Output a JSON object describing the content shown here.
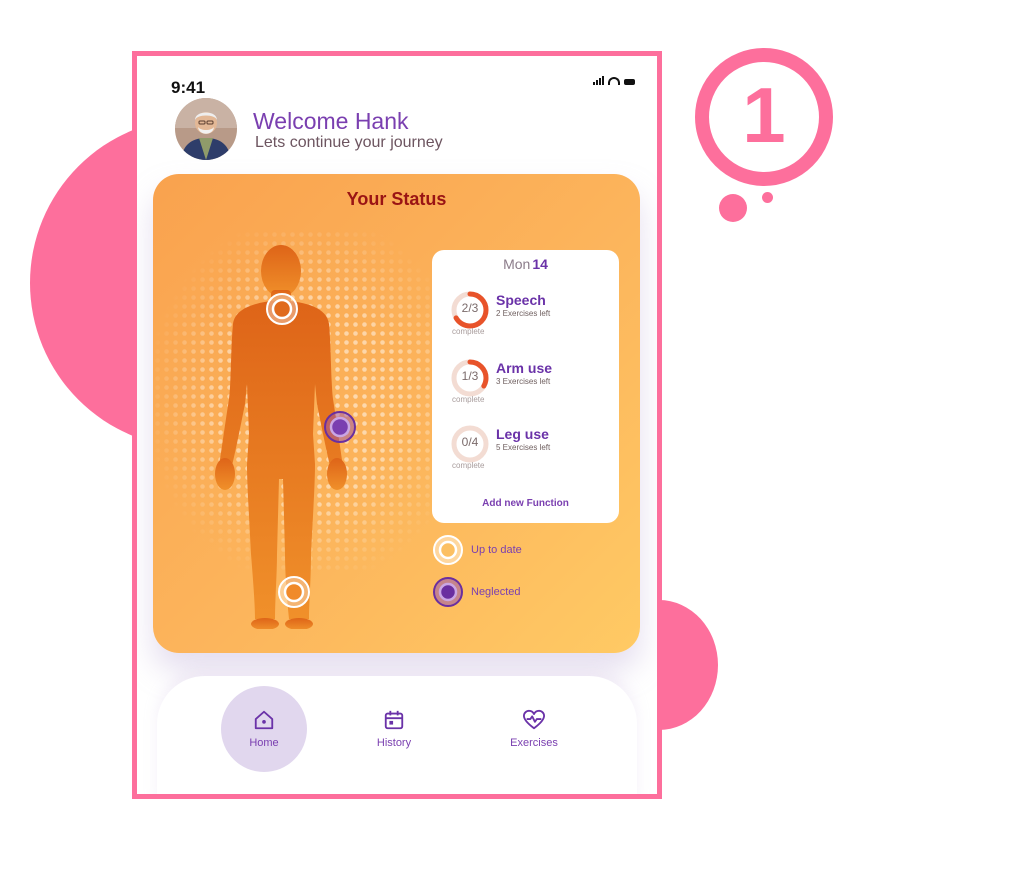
{
  "step_marker": {
    "number": "1"
  },
  "status_bar": {
    "time": "9:41"
  },
  "header": {
    "welcome": "Welcome Hank",
    "subtitle": "Lets continue your journey"
  },
  "status_card": {
    "title": "Your Status",
    "day": {
      "weekday": "Mon",
      "date": "14"
    },
    "functions": [
      {
        "name": "Speech",
        "progress": "2/3",
        "done": 2,
        "total": 3,
        "exercises_left": "2 Exercises left",
        "complete_label": "complete"
      },
      {
        "name": "Arm use",
        "progress": "1/3",
        "done": 1,
        "total": 3,
        "exercises_left": "3 Exercises left",
        "complete_label": "complete"
      },
      {
        "name": "Leg use",
        "progress": "0/4",
        "done": 0,
        "total": 4,
        "exercises_left": "5 Exercises left",
        "complete_label": "complete"
      }
    ],
    "add_function_label": "Add new Function",
    "legend": [
      {
        "label": "Up to date",
        "color": "#ffffff"
      },
      {
        "label": "Neglected",
        "color": "#6a2fa0"
      }
    ]
  },
  "bottom_nav": {
    "items": [
      {
        "label": "Home",
        "icon": "home-icon",
        "active": true
      },
      {
        "label": "History",
        "icon": "calendar-icon",
        "active": false
      },
      {
        "label": "Exercises",
        "icon": "heart-pulse-icon",
        "active": false
      }
    ]
  },
  "colors": {
    "accent_pink": "#fd6f9c",
    "brand_purple": "#7a3fb0",
    "status_orange": "#f9a24e",
    "progress_red": "#e8532a"
  }
}
